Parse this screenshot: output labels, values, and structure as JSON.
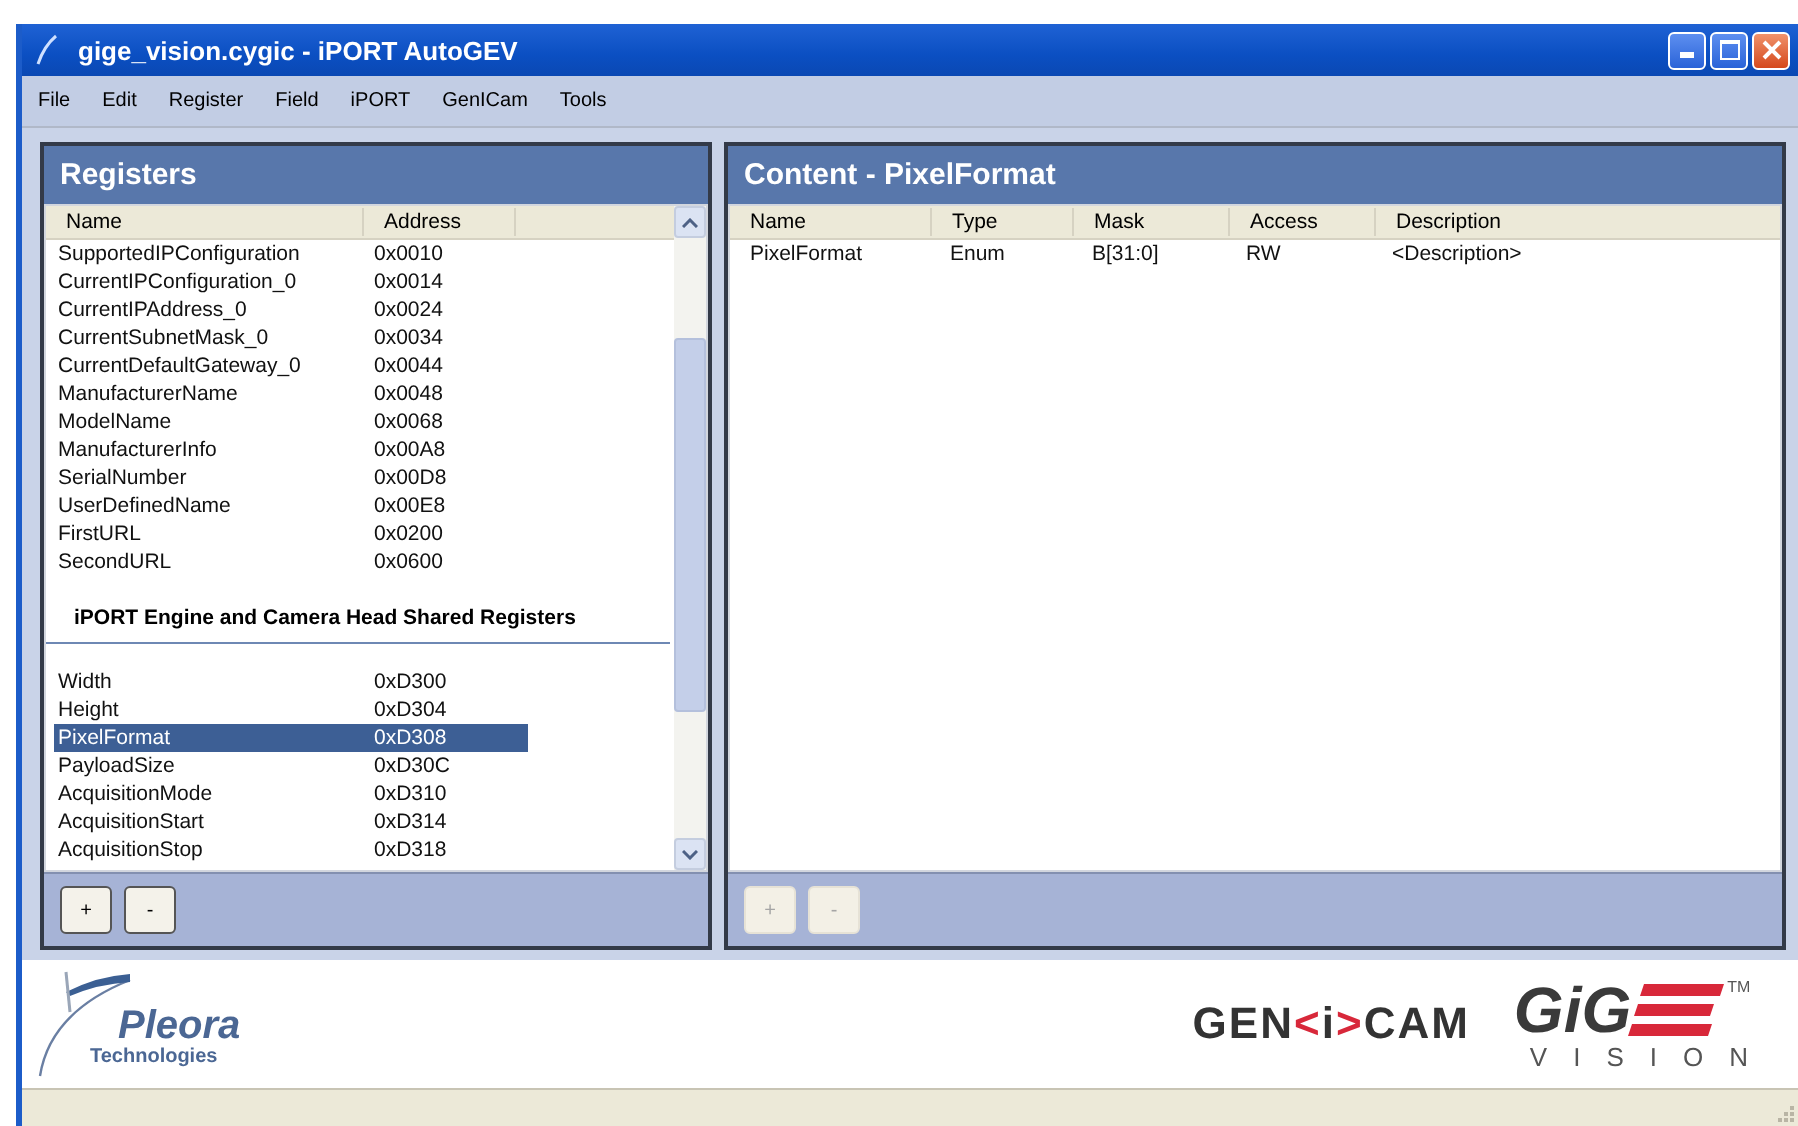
{
  "window": {
    "title": "gige_vision.cygic - iPORT AutoGEV"
  },
  "menu": [
    {
      "label": "File"
    },
    {
      "label": "Edit"
    },
    {
      "label": "Register"
    },
    {
      "label": "Field"
    },
    {
      "label": "iPORT"
    },
    {
      "label": "GenICam"
    },
    {
      "label": "Tools"
    }
  ],
  "registers": {
    "title": "Registers",
    "columns": [
      "Name",
      "Address"
    ],
    "rows": [
      {
        "kind": "row",
        "name": "SupportedIPConfiguration",
        "address": "0x0010",
        "selected": false
      },
      {
        "kind": "row",
        "name": "CurrentIPConfiguration_0",
        "address": "0x0014",
        "selected": false
      },
      {
        "kind": "row",
        "name": "CurrentIPAddress_0",
        "address": "0x0024",
        "selected": false
      },
      {
        "kind": "row",
        "name": "CurrentSubnetMask_0",
        "address": "0x0034",
        "selected": false
      },
      {
        "kind": "row",
        "name": "CurrentDefaultGateway_0",
        "address": "0x0044",
        "selected": false
      },
      {
        "kind": "row",
        "name": "ManufacturerName",
        "address": "0x0048",
        "selected": false
      },
      {
        "kind": "row",
        "name": "ModelName",
        "address": "0x0068",
        "selected": false
      },
      {
        "kind": "row",
        "name": "ManufacturerInfo",
        "address": "0x00A8",
        "selected": false
      },
      {
        "kind": "row",
        "name": "SerialNumber",
        "address": "0x00D8",
        "selected": false
      },
      {
        "kind": "row",
        "name": "UserDefinedName",
        "address": "0x00E8",
        "selected": false
      },
      {
        "kind": "row",
        "name": "FirstURL",
        "address": "0x0200",
        "selected": false
      },
      {
        "kind": "row",
        "name": "SecondURL",
        "address": "0x0600",
        "selected": false
      },
      {
        "kind": "group",
        "name": "iPORT Engine and Camera Head Shared Registers"
      },
      {
        "kind": "row",
        "name": "Width",
        "address": "0xD300",
        "selected": false
      },
      {
        "kind": "row",
        "name": "Height",
        "address": "0xD304",
        "selected": false
      },
      {
        "kind": "row",
        "name": "PixelFormat",
        "address": "0xD308",
        "selected": true
      },
      {
        "kind": "row",
        "name": "PayloadSize",
        "address": "0xD30C",
        "selected": false
      },
      {
        "kind": "row",
        "name": "AcquisitionMode",
        "address": "0xD310",
        "selected": false
      },
      {
        "kind": "row",
        "name": "AcquisitionStart",
        "address": "0xD314",
        "selected": false
      },
      {
        "kind": "row",
        "name": "AcquisitionStop",
        "address": "0xD318",
        "selected": false
      }
    ],
    "buttons": [
      {
        "label": "+",
        "disabled": false
      },
      {
        "label": "-",
        "disabled": false
      }
    ]
  },
  "content": {
    "title": "Content - PixelFormat",
    "columns": [
      "Name",
      "Type",
      "Mask",
      "Access",
      "Description"
    ],
    "rows": [
      [
        "PixelFormat",
        "Enum",
        "B[31:0]",
        "RW",
        "<Description>"
      ]
    ],
    "buttons": [
      {
        "label": "+",
        "disabled": true
      },
      {
        "label": "-",
        "disabled": true
      }
    ]
  },
  "logos": {
    "pleora": {
      "name": "Pleora",
      "subtitle": "Technologies"
    },
    "genicam": {
      "parts": [
        {
          "text": "GEN",
          "color": "#333333"
        },
        {
          "text": "<",
          "color": "#d8283a"
        },
        {
          "text": "i",
          "color": "#333333"
        },
        {
          "text": ">",
          "color": "#d8283a"
        },
        {
          "text": "CAM",
          "color": "#333333"
        }
      ]
    },
    "gige": {
      "text": "GiG",
      "trademark": "TM",
      "subtitle": "VISION"
    }
  }
}
